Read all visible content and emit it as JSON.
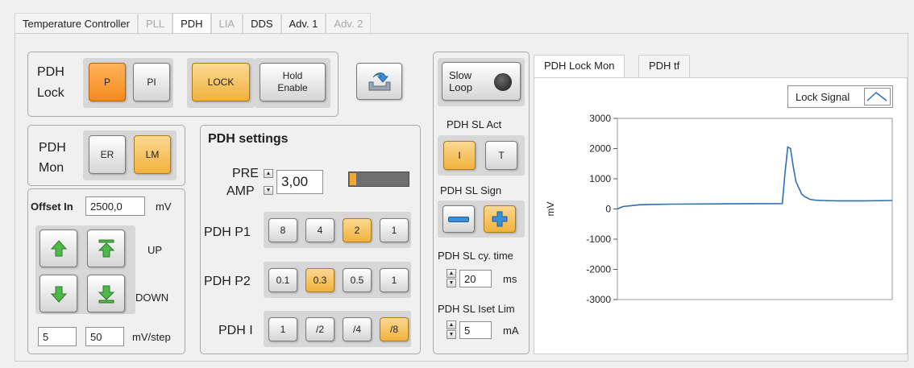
{
  "tabs": [
    {
      "label": "Temperature Controller",
      "state": "normal"
    },
    {
      "label": "PLL",
      "state": "disabled"
    },
    {
      "label": "PDH",
      "state": "active"
    },
    {
      "label": "LIA",
      "state": "disabled"
    },
    {
      "label": "DDS",
      "state": "normal"
    },
    {
      "label": "Adv. 1",
      "state": "normal"
    },
    {
      "label": "Adv. 2",
      "state": "disabled"
    }
  ],
  "lock": {
    "label_line1": "PDH",
    "label_line2": "Lock",
    "p": "P",
    "pi": "PI",
    "lock": "LOCK",
    "hold_line1": "Hold",
    "hold_line2": "Enable"
  },
  "mon": {
    "label_line1": "PDH",
    "label_line2": "Mon",
    "er": "ER",
    "lm": "LM"
  },
  "offset": {
    "label": "Offset In",
    "value": "2500,0",
    "unit": "mV",
    "up": "UP",
    "down": "DOWN",
    "step_coarse": "5",
    "step_fine": "50",
    "step_unit": "mV/step"
  },
  "settings": {
    "title": "PDH settings",
    "pre": "PRE",
    "amp": "AMP",
    "amp_value": "3,00",
    "p1_label": "PDH P1",
    "p1_options": [
      "8",
      "4",
      "2",
      "1"
    ],
    "p1_selected": "2",
    "p2_label": "PDH P2",
    "p2_options": [
      "0.1",
      "0.3",
      "0.5",
      "1"
    ],
    "p2_selected": "0.3",
    "i_label": "PDH I",
    "i_options": [
      "1",
      "/2",
      "/4",
      "/8"
    ],
    "i_selected": "/8"
  },
  "slow": {
    "label_line1": "Slow",
    "label_line2": "Loop",
    "act_label": "PDH SL Act",
    "act_i": "I",
    "act_t": "T",
    "sign_label": "PDH SL Sign",
    "cycle_label": "PDH SL cy. time",
    "cycle_value": "20",
    "cycle_unit": "ms",
    "iset_label": "PDH SL Iset Lim",
    "iset_value": "5",
    "iset_unit": "mA"
  },
  "chart_tabs": [
    "PDH Lock Mon",
    "PDH tf"
  ],
  "chart_data": {
    "type": "line",
    "ylabel": "mV",
    "ylim": [
      -3000,
      3000
    ],
    "yticks": [
      "3000",
      "2000",
      "1000",
      "0",
      "-1000",
      "-2000",
      "-3000"
    ],
    "legend": "Lock Signal",
    "legend_placement": "top-right",
    "color": "#2e6fb5",
    "series": [
      {
        "name": "Lock Signal",
        "x": [
          0,
          2,
          5,
          8,
          12,
          20,
          40,
          60,
          61,
          62,
          63,
          64,
          65,
          66,
          67,
          68,
          70,
          72,
          75,
          80,
          90,
          100
        ],
        "y": [
          0,
          80,
          110,
          140,
          150,
          160,
          170,
          180,
          1200,
          2050,
          2000,
          1400,
          900,
          700,
          500,
          420,
          320,
          290,
          280,
          270,
          270,
          280
        ]
      }
    ]
  }
}
